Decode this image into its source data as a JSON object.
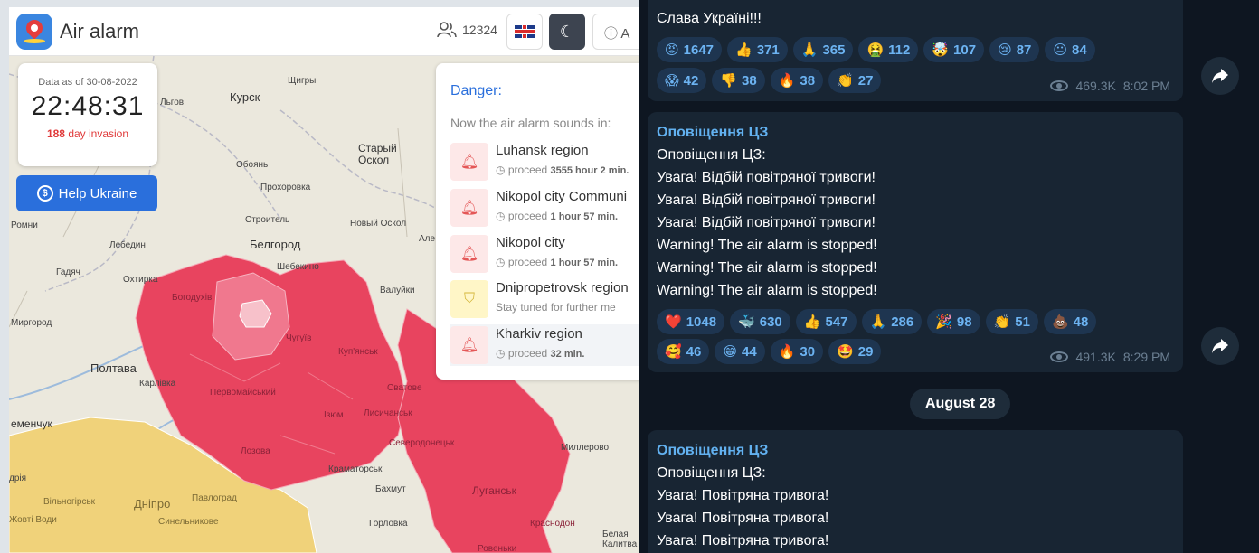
{
  "app": {
    "title": "Air alarm",
    "users_count": "12324",
    "about_label": "A",
    "clock": {
      "date_label": "Data as of 30-08-2022",
      "time": "22:48:31",
      "invasion_days": "188",
      "invasion_suffix": " day invasion"
    },
    "help_button": "Help Ukraine",
    "danger": {
      "title": "Danger:",
      "subtitle": "Now the air alarm sounds in:",
      "items": [
        {
          "name": "Luhansk region",
          "prefix": "proceed ",
          "duration": "3555 hour 2 min.",
          "kind": "alarm"
        },
        {
          "name": "Nikopol city Communi",
          "prefix": "proceed ",
          "duration": "1 hour 57 min.",
          "kind": "alarm"
        },
        {
          "name": "Nikopol city",
          "prefix": "proceed ",
          "duration": "1 hour 57 min.",
          "kind": "alarm"
        },
        {
          "name": "Dnipropetrovsk region",
          "prefix": "Stay tuned for further me",
          "duration": "",
          "kind": "warning"
        },
        {
          "name": "Kharkiv region",
          "prefix": "proceed ",
          "duration": "32 min.",
          "kind": "alarm"
        }
      ]
    },
    "map_labels": {
      "kursk": "Курск",
      "lgov": "Льгов",
      "shchigry": "Щигры",
      "oboyan": "Обоянь",
      "stary_oskol": "Старый\nОскол",
      "prokhorovka": "Прохоровка",
      "stroitel": "Строитель",
      "novy_oskol": "Новый Оскол",
      "romny": "Ромни",
      "lebedin": "Лебедин",
      "belgorod": "Белгород",
      "shebekino": "Шебекино",
      "gadyach": "Гадяч",
      "okhtyrka": "Охтирка",
      "valuyki": "Валуйки",
      "bohodukhiv": "Богодухів",
      "myrhorod": "Миргород",
      "chuhuiv": "Чугуїв",
      "kupiansk": "Куп'янськ",
      "poltava": "Полтава",
      "karlivka": "Карлівка",
      "pervomaiskyi": "Первомайський",
      "izium": "Ізюм",
      "svatove": "Сватове",
      "lysychansk": "Лисичанськ",
      "lozova": "Лозова",
      "severodonetsk": "Северодонецьк",
      "millerovo": "Миллерово",
      "kremenchuk": "еменчук",
      "kramatorsk": "Краматорськ",
      "bakhmut": "Бахмут",
      "luhansk": "Луганськ",
      "dnipro": "Дніпро",
      "vilnohirsk": "Вільногірськ",
      "pavlohrad": "Павлоград",
      "synelnykove": "Синельникове",
      "horlovka": "Горловка",
      "krasnodon": "Краснодон",
      "zhovti_vody": "Жовті Води",
      "dria": "дрія",
      "rovenky": "Ровеньки",
      "bila_kalytva": "Белая\nКалитва",
      "ala": "Але"
    }
  },
  "telegram": {
    "msg1": {
      "last_line": "Слава Україні!!!",
      "reactions_row1": [
        {
          "emoji": "😡",
          "count": "1647"
        },
        {
          "emoji": "👍",
          "count": "371"
        },
        {
          "emoji": "🙏",
          "count": "365"
        },
        {
          "emoji": "🤮",
          "count": "112"
        },
        {
          "emoji": "🤯",
          "count": "107"
        },
        {
          "emoji": "😢",
          "count": "87"
        },
        {
          "emoji": "😐",
          "count": "84"
        }
      ],
      "reactions_row2": [
        {
          "emoji": "😱",
          "count": "42"
        },
        {
          "emoji": "👎",
          "count": "38"
        },
        {
          "emoji": "🔥",
          "count": "38"
        },
        {
          "emoji": "👏",
          "count": "27"
        }
      ],
      "views": "469.3K",
      "time": "8:02 PM"
    },
    "msg2": {
      "author": "Оповіщення ЦЗ",
      "lines": [
        "Оповіщення ЦЗ:",
        "Увага! Відбій повітряної тривоги!",
        "Увага! Відбій повітряної тривоги!",
        "Увага! Відбій повітряної тривоги!",
        "Warning! The air alarm is stopped!",
        "Warning! The air alarm is stopped!",
        "Warning! The air alarm is stopped!"
      ],
      "reactions_row1": [
        {
          "emoji": "❤️",
          "count": "1048"
        },
        {
          "emoji": "🐳",
          "count": "630"
        },
        {
          "emoji": "👍",
          "count": "547"
        },
        {
          "emoji": "🙏",
          "count": "286"
        },
        {
          "emoji": "🎉",
          "count": "98"
        },
        {
          "emoji": "👏",
          "count": "51"
        },
        {
          "emoji": "💩",
          "count": "48"
        }
      ],
      "reactions_row2": [
        {
          "emoji": "🥰",
          "count": "46"
        },
        {
          "emoji": "😁",
          "count": "44"
        },
        {
          "emoji": "🔥",
          "count": "30"
        },
        {
          "emoji": "🤩",
          "count": "29"
        }
      ],
      "views": "491.3K",
      "time": "8:29 PM"
    },
    "date_divider": "August 28",
    "msg3": {
      "author": "Оповіщення ЦЗ",
      "lines": [
        "Оповіщення ЦЗ:",
        "Увага! Повітряна тривога!",
        "Увага! Повітряна тривога!",
        "Увага! Повітряна тривога!"
      ]
    },
    "forward_icon": "share-arrow-icon"
  },
  "colors": {
    "alarm_red": "#e8445f",
    "warning_yellow": "#f0d27a",
    "telegram_bg": "#0e1621",
    "bubble_bg": "#182533",
    "accent_blue": "#2a6fdc"
  }
}
